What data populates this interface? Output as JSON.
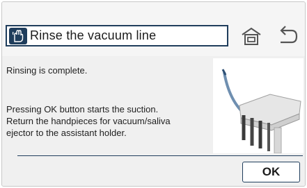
{
  "header": {
    "title": "Rinse the vacuum line",
    "title_icon": "hand-rinse-icon",
    "home_icon": "home-icon",
    "back_icon": "back-arrow-icon"
  },
  "content": {
    "status_message": "Rinsing is complete.",
    "instruction_line1": "Pressing OK button starts the suction.",
    "instruction_line2": "Return the handpieces for vacuum/saliva",
    "instruction_line3": "ejector to the assistant holder.",
    "illustration": "assistant-holder-handpieces-illustration"
  },
  "actions": {
    "ok_label": "OK"
  },
  "colors": {
    "accent": "#1f3d5c",
    "panel": "#f0f0f0",
    "header": "#f5f5f5"
  }
}
